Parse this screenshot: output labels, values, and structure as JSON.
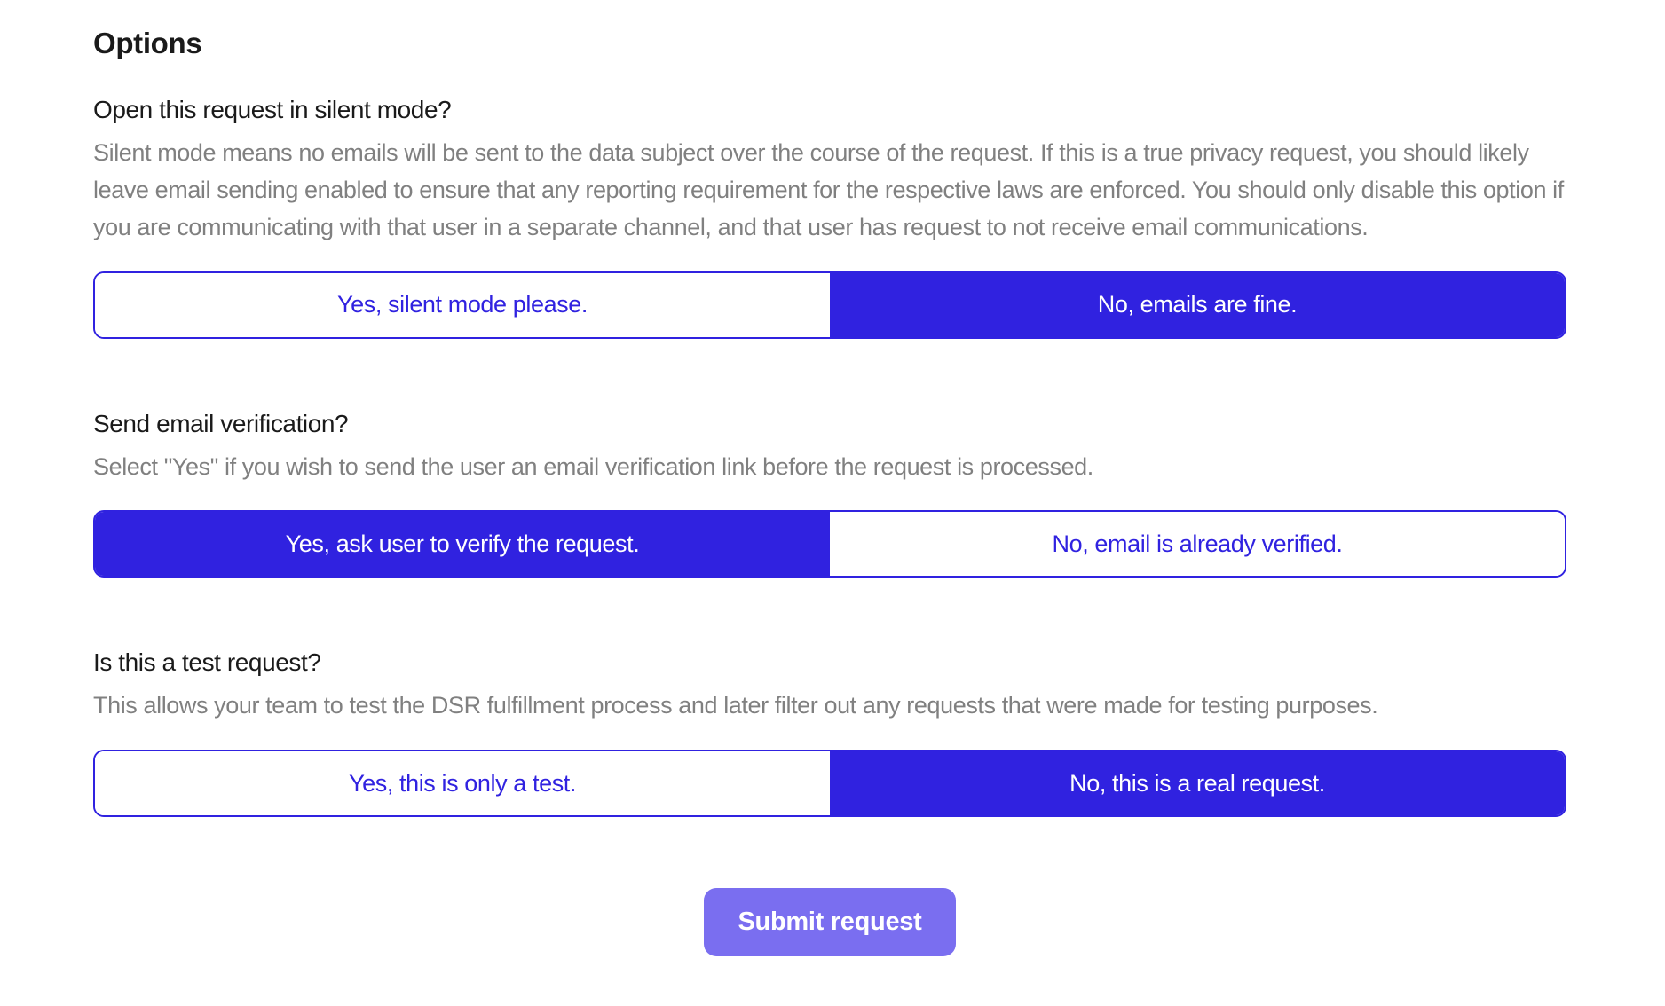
{
  "title": "Options",
  "options": [
    {
      "key": "silent_mode",
      "question": "Open this request in silent mode?",
      "description": "Silent mode means no emails will be sent to the data subject over the course of the request. If this is a true privacy request, you should likely leave email sending enabled to ensure that any reporting requirement for the respective laws are enforced. You should only disable this option if you are communicating with that user in a separate channel, and that user has request to not receive email communications.",
      "yes_label": "Yes, silent mode please.",
      "no_label": "No, emails are fine.",
      "selected": "no",
      "focused": false
    },
    {
      "key": "email_verification",
      "question": "Send email verification?",
      "description": "Select \"Yes\" if you wish to send the user an email verification link before the request is processed.",
      "yes_label": "Yes, ask user to verify the request.",
      "no_label": "No, email is already verified.",
      "selected": "yes",
      "focused": true
    },
    {
      "key": "test_request",
      "question": "Is this a test request?",
      "description": "This allows your team to test the DSR fulfillment process and later filter out any requests that were made for testing purposes.",
      "yes_label": "Yes, this is only a test.",
      "no_label": "No, this is a real request.",
      "selected": "no",
      "focused": false
    }
  ],
  "submit_label": "Submit request",
  "colors": {
    "primary": "#3022e0",
    "submit_bg": "#7a6ef0",
    "muted_text": "#808080"
  }
}
